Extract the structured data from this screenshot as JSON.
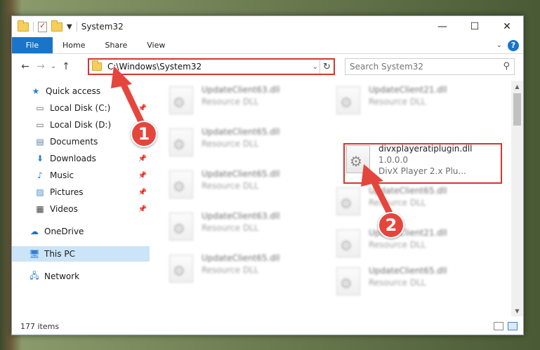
{
  "window": {
    "title": "System32",
    "controls": {
      "minimize": "—",
      "maximize": "☐",
      "close": "✕"
    }
  },
  "ribbon": {
    "tabs": [
      "File",
      "Home",
      "Share",
      "View"
    ],
    "help": "?"
  },
  "address": {
    "path": "C:\\Windows\\System32",
    "search_placeholder": "Search System32"
  },
  "nav": {
    "items": [
      {
        "label": "Quick access",
        "icon": "star-icon",
        "pinned": false
      },
      {
        "label": "Local Disk (C:)",
        "icon": "drive-icon",
        "pinned": true
      },
      {
        "label": "Local Disk (D:)",
        "icon": "drive-icon",
        "pinned": false
      },
      {
        "label": "Documents",
        "icon": "documents-icon",
        "pinned": true
      },
      {
        "label": "Downloads",
        "icon": "download-icon",
        "pinned": true
      },
      {
        "label": "Music",
        "icon": "music-icon",
        "pinned": true
      },
      {
        "label": "Pictures",
        "icon": "pictures-icon",
        "pinned": true
      },
      {
        "label": "Videos",
        "icon": "videos-icon",
        "pinned": true
      },
      {
        "label": "OneDrive",
        "icon": "cloud-icon",
        "pinned": false
      },
      {
        "label": "This PC",
        "icon": "computer-icon",
        "pinned": false,
        "selected": true
      },
      {
        "label": "Network",
        "icon": "network-icon",
        "pinned": false
      }
    ]
  },
  "files": {
    "left": [
      {
        "name": "UpdateClient63.dll",
        "type": "Resource DLL"
      },
      {
        "name": "UpdateClient65.dll",
        "type": "Resource DLL"
      },
      {
        "name": "UpdateClient65.dll",
        "type": "Resource DLL"
      },
      {
        "name": "UpdateClient63.dll",
        "type": "Resource DLL"
      },
      {
        "name": "UpdateClient65.dll",
        "type": "Resource DLL"
      }
    ],
    "right": [
      {
        "name": "UpdateClient21.dll",
        "type": "Resource DLL"
      },
      {
        "name": "divxplayeratiplugin.dll",
        "version": "1.0.0.0",
        "description": "DivX Player 2.x Plu..."
      },
      {
        "name": "UpdateClient65.dll",
        "type": "Resource DLL"
      },
      {
        "name": "UpdateClient21.dll",
        "type": "Resource DLL"
      },
      {
        "name": "UpdateClient65.dll",
        "type": "Resource DLL"
      }
    ]
  },
  "status": {
    "count": "177 items"
  },
  "annotations": {
    "step1": "1",
    "step2": "2",
    "color": "#e4463d"
  }
}
